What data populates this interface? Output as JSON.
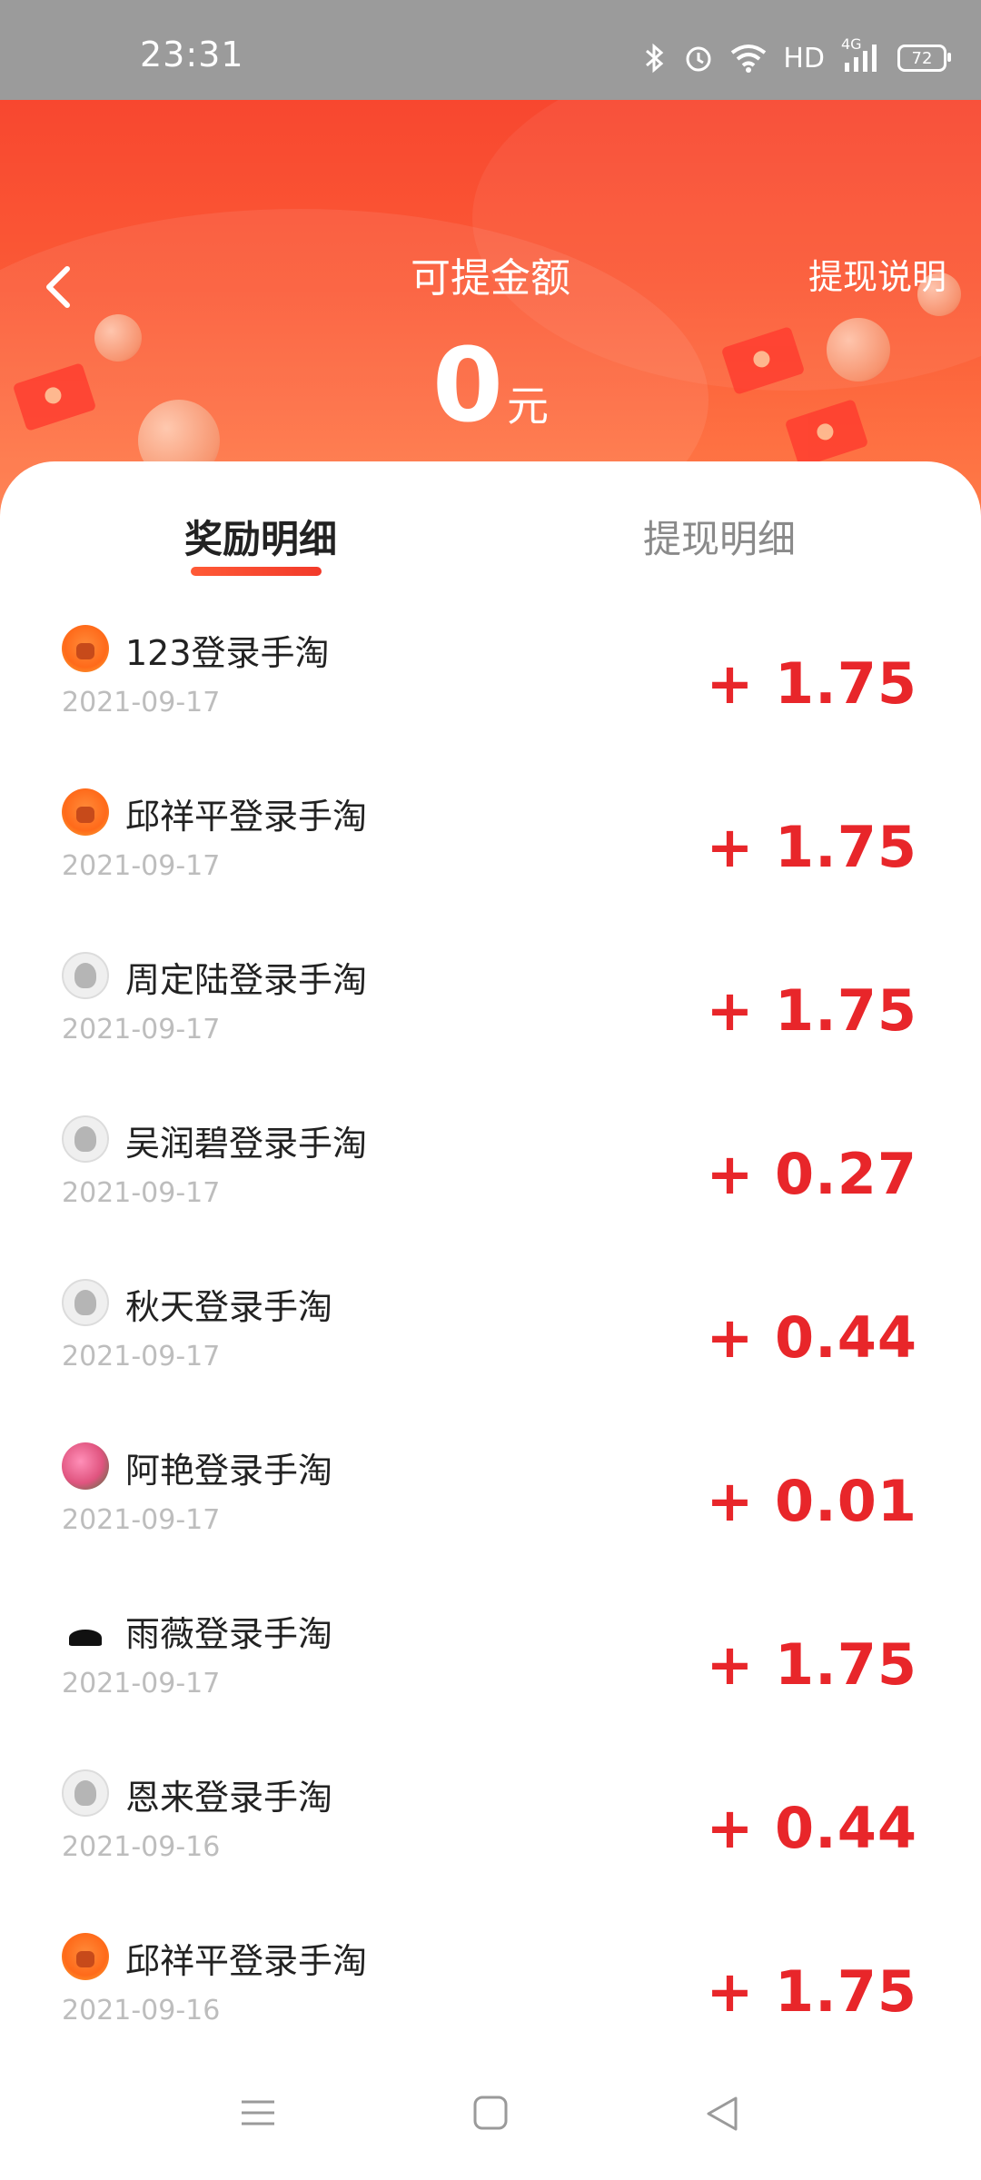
{
  "status_bar": {
    "time": "23:31",
    "battery": "72",
    "icons": [
      "bluetooth-icon",
      "alarm-icon",
      "wifi-icon",
      "hd-icon",
      "signal-4g-icon",
      "battery-icon"
    ],
    "hd_label": "HD",
    "net_label": "4G"
  },
  "header": {
    "title": "可提金额",
    "withdraw_rule": "提现说明",
    "amount": "0",
    "unit": "元",
    "colors": {
      "gradient_top": "#f8472f",
      "gradient_bottom": "#ff7b48"
    }
  },
  "tabs": [
    {
      "label": "奖励明细",
      "active": true
    },
    {
      "label": "提现明细",
      "active": false
    }
  ],
  "records": [
    {
      "name": "123登录手淘",
      "date": "2021-09-17",
      "value": "+ 1.75",
      "avatar": "orange-mascot"
    },
    {
      "name": "邱祥平登录手淘",
      "date": "2021-09-17",
      "value": "+ 1.75",
      "avatar": "orange-mascot"
    },
    {
      "name": "周定陆登录手淘",
      "date": "2021-09-17",
      "value": "+ 1.75",
      "avatar": "grey-default"
    },
    {
      "name": "吴润碧登录手淘",
      "date": "2021-09-17",
      "value": "+ 0.27",
      "avatar": "grey-default"
    },
    {
      "name": "秋天登录手淘",
      "date": "2021-09-17",
      "value": "+ 0.44",
      "avatar": "grey-default"
    },
    {
      "name": "阿艳登录手淘",
      "date": "2021-09-17",
      "value": "+ 0.01",
      "avatar": "flower-photo"
    },
    {
      "name": "雨薇登录手淘",
      "date": "2021-09-17",
      "value": "+ 1.75",
      "avatar": "ink-photo"
    },
    {
      "name": "恩来登录手淘",
      "date": "2021-09-16",
      "value": "+ 0.44",
      "avatar": "grey-default"
    },
    {
      "name": "邱祥平登录手淘",
      "date": "2021-09-16",
      "value": "+ 1.75",
      "avatar": "orange-mascot"
    }
  ],
  "accent_color": "#e8262a",
  "nav_bar": [
    "menu-icon",
    "home-icon",
    "back-triangle-icon"
  ]
}
